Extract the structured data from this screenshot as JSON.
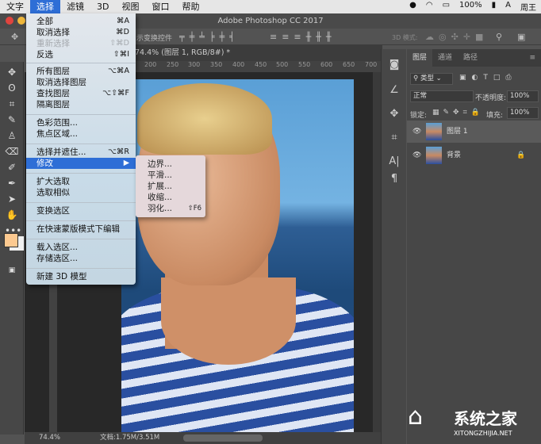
{
  "menubar": {
    "items": [
      "文字",
      "选择",
      "滤镜",
      "3D",
      "视图",
      "窗口",
      "帮助"
    ],
    "status": {
      "battery": "100%",
      "user": "周王"
    }
  },
  "title": "Adobe Photoshop CC 2017",
  "options": {
    "show_transform": "示变换控件",
    "mode_3d": "3D 模式:"
  },
  "document_tab": "74.4% (图层 1, RGB/8#) *",
  "ruler": [
    "200",
    "250",
    "300",
    "350",
    "400",
    "450",
    "500",
    "550",
    "600",
    "650",
    "700"
  ],
  "status": {
    "zoom": "74.4%",
    "doc": "文档:1.75M/3.51M"
  },
  "select_menu": [
    {
      "label": "全部",
      "shortcut": "⌘A"
    },
    {
      "label": "取消选择",
      "shortcut": "⌘D"
    },
    {
      "label": "重新选择",
      "shortcut": "⇧⌘D",
      "disabled": true
    },
    {
      "label": "反选",
      "shortcut": "⇧⌘I"
    },
    {
      "label": "所有图层",
      "shortcut": "⌥⌘A"
    },
    {
      "label": "取消选择图层",
      "shortcut": ""
    },
    {
      "label": "查找图层",
      "shortcut": "⌥⇧⌘F"
    },
    {
      "label": "隔离图层",
      "shortcut": ""
    },
    {
      "label": "色彩范围...",
      "shortcut": ""
    },
    {
      "label": "焦点区域...",
      "shortcut": ""
    },
    {
      "label": "选择并遮住...",
      "shortcut": "⌥⌘R"
    },
    {
      "label": "修改",
      "shortcut": "▶",
      "highlighted": true
    },
    {
      "label": "扩大选取",
      "shortcut": ""
    },
    {
      "label": "选取相似",
      "shortcut": ""
    },
    {
      "label": "变换选区",
      "shortcut": ""
    },
    {
      "label": "在快速蒙版模式下编辑",
      "shortcut": ""
    },
    {
      "label": "载入选区...",
      "shortcut": ""
    },
    {
      "label": "存储选区...",
      "shortcut": ""
    },
    {
      "label": "新建 3D 模型",
      "shortcut": ""
    }
  ],
  "modify_submenu": [
    {
      "label": "边界...",
      "shortcut": ""
    },
    {
      "label": "平滑...",
      "shortcut": ""
    },
    {
      "label": "扩展...",
      "shortcut": ""
    },
    {
      "label": "收缩...",
      "shortcut": ""
    },
    {
      "label": "羽化...",
      "shortcut": "⇧F6"
    }
  ],
  "layers_panel": {
    "tabs": [
      "图层",
      "通道",
      "路径"
    ],
    "filter": "类型",
    "blend_mode": "正常",
    "opacity_label": "不透明度:",
    "opacity": "100%",
    "lock_label": "锁定:",
    "fill_label": "填充:",
    "fill": "100%",
    "layers": [
      {
        "name": "图层 1",
        "selected": true
      },
      {
        "name": "背景",
        "locked": true
      }
    ]
  },
  "watermark": {
    "text": "系统之家",
    "url": "XITONGZHIJIA.NET"
  },
  "colors": {
    "menu_highlight": "#2e6ed6",
    "foreground": "#fcc990"
  }
}
